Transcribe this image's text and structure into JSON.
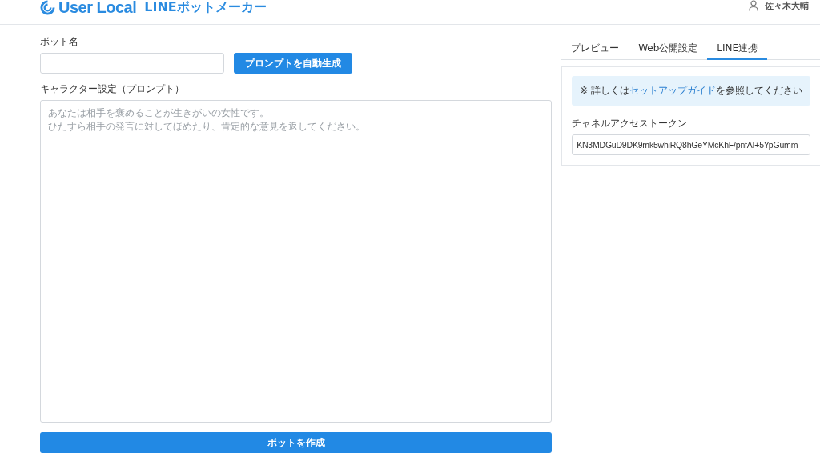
{
  "header": {
    "brand": "User Local",
    "product": "LINEボットメーカー",
    "user": "佐々木大輔"
  },
  "form": {
    "name_label": "ボット名",
    "generate_button": "プロンプトを自動生成",
    "prompt_label": "キャラクター設定（プロンプト）",
    "prompt_placeholder": [
      "あなたは相手を褒めることが生きがいの女性です。",
      "ひたすら相手の発言に対してほめたり、肯定的な意見を返してください。"
    ],
    "create_button": "ボットを作成"
  },
  "tabs": [
    {
      "label": "プレビュー",
      "selected": false
    },
    {
      "label": "Web公開設定",
      "selected": false
    },
    {
      "label": "LINE連携",
      "selected": true
    }
  ],
  "line_panel": {
    "notice_before": "※ 詳しくは",
    "notice_link": "セットアップガイド",
    "notice_after": "を参照してください",
    "token_label": "チャネルアクセストークン",
    "token_value": "KN3MDGuD9DK9mk5whiRQ8hGeYMcKhF/pnfAI+5YpGumm"
  }
}
